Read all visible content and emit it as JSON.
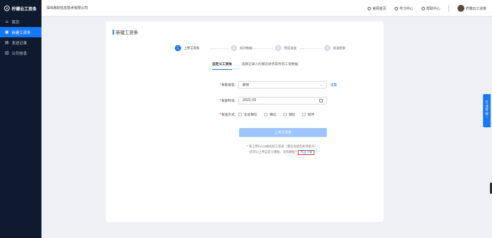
{
  "sidebar": {
    "logo_text": "柠檬云工资条",
    "items": [
      {
        "label": "首页",
        "icon": "home-icon",
        "active": false
      },
      {
        "label": "新建工资条",
        "icon": "new-doc-icon",
        "active": true
      },
      {
        "label": "发送记录",
        "icon": "record-icon",
        "active": false
      },
      {
        "label": "公司信息",
        "icon": "company-icon",
        "active": false
      }
    ]
  },
  "header": {
    "company_name": "深圳易财信息技术有限公司",
    "links": [
      {
        "label": "官网首页",
        "icon": "globe-icon"
      },
      {
        "label": "学习中心",
        "icon": "learn-icon"
      },
      {
        "label": "帮助中心",
        "icon": "help-icon"
      }
    ],
    "user_name": "柠檬云工资条"
  },
  "page": {
    "title": "新建工资条",
    "steps": [
      {
        "num": "1",
        "label": "上传工资条",
        "active": true
      },
      {
        "num": "2",
        "label": "核对数据",
        "active": false
      },
      {
        "num": "3",
        "label": "预览发送",
        "active": false
      },
      {
        "num": "4",
        "label": "发送结果",
        "active": false
      }
    ],
    "tabs": [
      {
        "label": "自定义工资条",
        "active": true
      },
      {
        "label": "选择已录入柠檬云财务软件的工资数据",
        "active": false
      }
    ],
    "form": {
      "type_label": "发薪类型:",
      "type_value": "薪资",
      "type_setting": "设置",
      "time_label": "发薪时间:",
      "time_value": "2021-01",
      "method_label": "发送方式:",
      "methods": [
        "企业微信",
        "微信",
        "短信",
        "邮件"
      ]
    },
    "upload_button": "上传工资条",
    "tip_line1": "* 请上传Excel格式的工资表（需包含姓名和手机号）",
    "tip_line2_prefix": "您可以上传自定义模板，没有模板？",
    "tip_link": "点击下载"
  },
  "float_help": {
    "chars": [
      "在",
      "线",
      "客",
      "服"
    ]
  },
  "colors": {
    "primary": "#1677ff",
    "sidebar_bg": "#0e1a2e",
    "highlight": "#e53935"
  }
}
